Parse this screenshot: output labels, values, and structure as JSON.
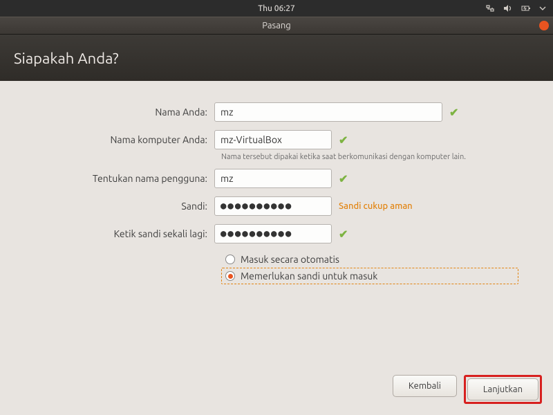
{
  "topbar": {
    "time": "Thu 06:27"
  },
  "titlebar": {
    "title": "Pasang"
  },
  "heading": {
    "text": "Siapakah Anda?"
  },
  "form": {
    "name": {
      "label": "Nama Anda:",
      "value": "mz"
    },
    "computer": {
      "label": "Nama komputer Anda:",
      "value": "mz-VirtualBox",
      "hint": "Nama tersebut dipakai ketika saat berkomunikasi dengan komputer lain."
    },
    "username": {
      "label": "Tentukan nama pengguna:",
      "value": "mz"
    },
    "password": {
      "label": "Sandi:",
      "value": "●●●●●●●●●●",
      "status": "Sandi cukup aman"
    },
    "confirm": {
      "label": "Ketik sandi sekali lagi:",
      "value": "●●●●●●●●●●"
    },
    "options": {
      "auto": "Masuk secara otomatis",
      "require": "Memerlukan sandi untuk masuk"
    }
  },
  "footer": {
    "back": "Kembali",
    "next": "Lanjutkan"
  }
}
